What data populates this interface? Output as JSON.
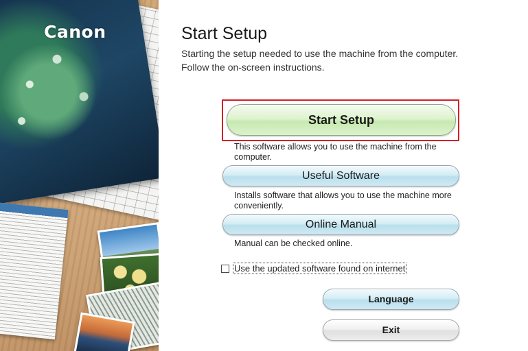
{
  "brand": {
    "logo_text": "Canon"
  },
  "header": {
    "title": "Start Setup",
    "intro_lines": [
      "Starting the setup needed to use the machine from the computer.",
      "Follow the on-screen instructions."
    ]
  },
  "options": {
    "start_setup": {
      "label": "Start Setup",
      "description": "This software allows you to use the machine from the computer.",
      "highlight_color": "#d42027"
    },
    "useful_software": {
      "label": "Useful Software",
      "description": "Installs software that allows you to use the machine more conveniently."
    },
    "online_manual": {
      "label": "Online Manual",
      "description": "Manual can be checked online."
    }
  },
  "update_checkbox": {
    "label": "Use the updated software found on internet",
    "checked": false
  },
  "footer": {
    "language_label": "Language",
    "exit_label": "Exit"
  }
}
